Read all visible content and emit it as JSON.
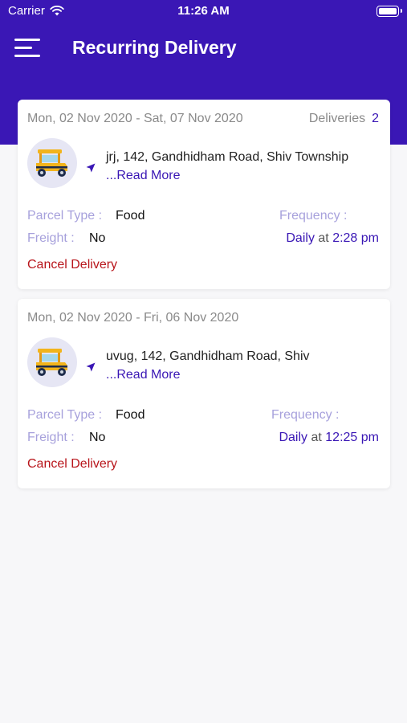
{
  "status_bar": {
    "carrier": "Carrier",
    "time": "11:26 AM"
  },
  "nav": {
    "title": "Recurring Delivery"
  },
  "deliveries": [
    {
      "dates": "Mon, 02 Nov 2020 - Sat, 07 Nov 2020",
      "deliveries_label": "Deliveries",
      "deliveries_count": "2",
      "address": "jrj, 142, Gandhidham Road, Shiv Township",
      "read_more": "...Read More",
      "parcel_type_label": "Parcel Type :",
      "parcel_type": "Food",
      "freight_label": "Freight :",
      "freight": "No",
      "frequency_label": "Frequency :",
      "frequency": "Daily",
      "at": "at",
      "time": "2:28 pm",
      "cancel": "Cancel Delivery"
    },
    {
      "dates": "Mon, 02 Nov 2020 - Fri, 06 Nov 2020",
      "address": "uvug, 142, Gandhidham Road, Shiv",
      "read_more": "...Read More",
      "parcel_type_label": "Parcel Type :",
      "parcel_type": "Food",
      "freight_label": "Freight :",
      "freight": "No",
      "frequency_label": "Frequency :",
      "frequency": "Daily",
      "at": "at",
      "time": "12:25 pm",
      "cancel": "Cancel Delivery"
    }
  ],
  "icons": {
    "menu": "hamburger-menu-icon",
    "vehicle": "auto-rickshaw-icon",
    "location": "navigation-arrow-icon",
    "wifi": "wifi-icon",
    "battery": "battery-icon"
  },
  "colors": {
    "primary": "#3a17b5",
    "label": "#a7a1dc",
    "cancel": "#b8151b",
    "background": "#f7f7f9"
  }
}
